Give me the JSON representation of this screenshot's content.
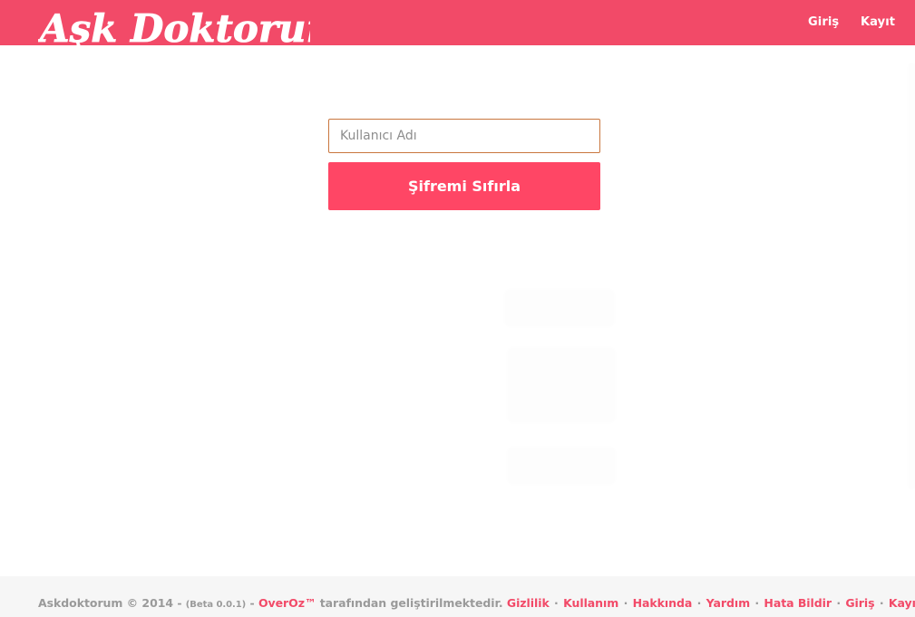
{
  "header": {
    "brand": "Aşk Doktorum",
    "nav": {
      "login": "Giriş",
      "register": "Kayıt"
    }
  },
  "form": {
    "username_placeholder": "Kullanıcı Adı",
    "username_value": "",
    "reset_button": "Şifremi Sıfırla"
  },
  "footer": {
    "copyright": "Askdoktorum © 2014 - ",
    "beta": "(Beta 0.0.1)",
    "sep_dash": " - ",
    "company": "OverOz™",
    "developed_by": " tarafından geliştirilmektedir. ",
    "links": {
      "privacy": "Gizlilik",
      "terms": "Kullanım",
      "about": "Hakkında",
      "help": "Yardım",
      "report": "Hata Bildir",
      "login": "Giriş",
      "register": "Kayıt"
    },
    "separator": "·"
  },
  "colors": {
    "brand": "#f24a68",
    "button": "#ff4665",
    "footer_bg": "#f6f6f6"
  }
}
